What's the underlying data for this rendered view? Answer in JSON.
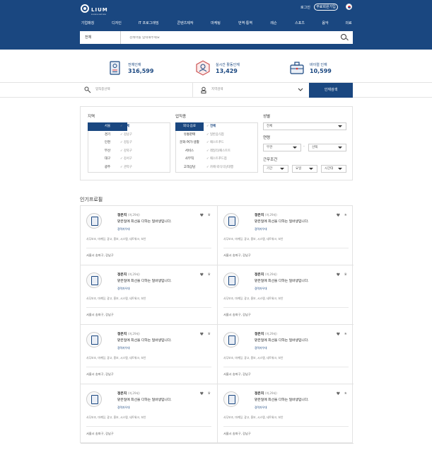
{
  "header": {
    "logo_text": "LIUM",
    "logo_sub": "BUSINESS MATCHING",
    "login_label": "로그인",
    "signup_label": "무료회원가입",
    "nav": [
      "기업매칭",
      "디자인",
      "IT 프로그래밍",
      "콘텐츠제작",
      "마케팅",
      "번역·통역",
      "레슨",
      "스포츠",
      "음악",
      "의료"
    ]
  },
  "search": {
    "category": "전체",
    "placeholder": "검색어를 입력해주세요"
  },
  "stats": [
    {
      "label": "전체인재",
      "value": "316,599",
      "icon": "id-card-icon"
    },
    {
      "label": "실시간 활동인재",
      "value": "13,429",
      "icon": "person-badge-icon"
    },
    {
      "label": "바이럴 인재",
      "value": "10,599",
      "icon": "briefcase-icon"
    }
  ],
  "filter_bar": {
    "field1": "업직종선택",
    "field2": "지역검색",
    "button": "인재검색"
  },
  "filters": {
    "region_title": "지역",
    "regions": [
      "서울",
      "경기",
      "인천",
      "부산",
      "대구",
      "광주"
    ],
    "region_sub": [
      "전체",
      "강남구",
      "강동구",
      "강북구",
      "강서구",
      "관악구"
    ],
    "job_title": "업직종",
    "jobs": [
      "외식·음료",
      "유통판매",
      "문화·여가·생활",
      "서비스",
      "사무직",
      "고객상담"
    ],
    "job_sub": [
      "전체",
      "일반음식점",
      "패스트푸드",
      "레일리/패스트트",
      "패스트푸드점",
      "카페·외식식당대행"
    ],
    "gender_title": "성별",
    "gender_value": "전체",
    "age_title": "연령",
    "age_from": "무관",
    "age_to": "선택",
    "work_title": "근무조건",
    "work_period": "기간",
    "work_day": "요일",
    "work_time": "시간대"
  },
  "popular_title": "인기프로필",
  "cards": [
    {
      "name": "정은지",
      "meta": "(여,29세)",
      "headline": "맡은일에 최선을 다하는 일바생입니다.",
      "tag": "경력자우대",
      "skills": "사무보조, 마케팅, 광고, 홍보, 시스템, 네트워크, 보안",
      "location": "서울시 송파구, 강남구"
    },
    {
      "name": "정은지",
      "meta": "(여,29세)",
      "headline": "맡은일에 최선을 다하는 일바생입니다.",
      "tag": "경력자우대",
      "skills": "사무보조, 마케팅, 광고, 홍보, 시스템, 네트워크, 보안",
      "location": "서울시 송파구, 강남구"
    },
    {
      "name": "정은지",
      "meta": "(여,29세)",
      "headline": "맡은일에 최선을 다하는 일바생입니다.",
      "tag": "경력자우대",
      "skills": "사무보조, 마케팅, 광고, 홍보, 시스템, 네트워크, 보안",
      "location": "서울시 송파구, 강남구"
    },
    {
      "name": "정은지",
      "meta": "(여,29세)",
      "headline": "맡은일에 최선을 다하는 일바생입니다.",
      "tag": "경력자우대",
      "skills": "사무보조, 마케팅, 광고, 홍보, 시스템, 네트워크, 보안",
      "location": "서울시 송파구, 강남구"
    },
    {
      "name": "정은지",
      "meta": "(여,29세)",
      "headline": "맡은일에 최선을 다하는 일바생입니다.",
      "tag": "경력자우대",
      "skills": "사무보조, 마케팅, 광고, 홍보, 시스템, 네트워크, 보안",
      "location": "서울시 송파구, 강남구"
    },
    {
      "name": "정은지",
      "meta": "(여,29세)",
      "headline": "맡은일에 최선을 다하는 일바생입니다.",
      "tag": "경력자우대",
      "skills": "사무보조, 마케팅, 광고, 홍보, 시스템, 네트워크, 보안",
      "location": "서울시 송파구, 강남구"
    },
    {
      "name": "정은지",
      "meta": "(여,29세)",
      "headline": "맡은일에 최선을 다하는 일바생입니다.",
      "tag": "경력자우대",
      "skills": "사무보조, 마케팅, 광고, 홍보, 시스템, 네트워크, 보안",
      "location": "서울시 송파구, 강남구"
    },
    {
      "name": "정은지",
      "meta": "(여,29세)",
      "headline": "맡은일에 최선을 다하는 일바생입니다.",
      "tag": "경력자우대",
      "skills": "사무보조, 마케팅, 광고, 홍보, 시스템, 네트워크, 보안",
      "location": "서울시 송파구, 강남구"
    }
  ],
  "colors": {
    "brand": "#1a4780",
    "accent_red": "#d33333"
  }
}
